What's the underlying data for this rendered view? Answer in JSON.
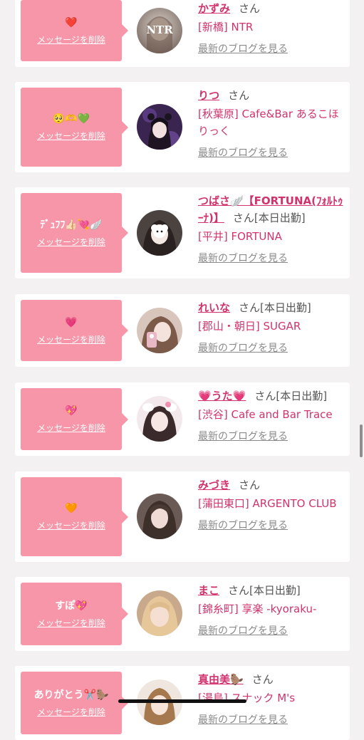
{
  "delete_label": "メッセージを削除",
  "blog_label": "最新のブログを見る",
  "honorific": "さん",
  "entries": [
    {
      "message": "❤️",
      "name": "かずみ",
      "status": "",
      "shop": "[新橋] NTR"
    },
    {
      "message": "🥺🫶💚",
      "name": "りつ",
      "status": "",
      "shop": "[秋葉原] Cafe&Bar あるこほりっく"
    },
    {
      "message": "ﾃﾞｭﾌﾌ👍🏻💘🪽",
      "name": "つばさ🪽【FORTUNA(ﾌｫﾙﾄｩｰﾅ)】",
      "status": "[本日出勤]",
      "shop": "[平井] FORTUNA"
    },
    {
      "message": "💗",
      "name": "れいな",
      "status": "[本日出勤]",
      "shop": "[郡山・朝日] SUGAR"
    },
    {
      "message": "💖",
      "name": "💗うた💗",
      "status": "[本日出勤]",
      "shop": "[渋谷] Cafe and Bar Trace"
    },
    {
      "message": "🧡",
      "name": "みづき",
      "status": "",
      "shop": "[蒲田東口] ARGENTO CLUB"
    },
    {
      "message": "すぽ💖",
      "name": "まこ",
      "status": "[本日出勤]",
      "shop": "[錦糸町] 享楽 -kyoraku-"
    },
    {
      "message": "ありがとう✂️🦫",
      "name": "真由美🦫",
      "status": "",
      "shop": "[湯島] スナック M's"
    }
  ],
  "colors": {
    "bubble": "#f796a9",
    "name": "#d0336d",
    "background": "#f3f1f2"
  }
}
